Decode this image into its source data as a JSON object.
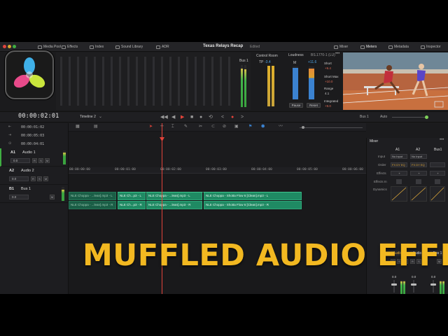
{
  "app": {
    "project_title": "Texas Relays Recap",
    "edited_label": "Edited",
    "colors": {
      "accent_red": "#e3433a",
      "clip_green": "#1f8a63",
      "overlay_yellow": "#f2b821",
      "background": "#1b1b1d"
    }
  },
  "toolbar_left": [
    {
      "label": "Media Pool",
      "icon": "media-pool-icon"
    },
    {
      "label": "Effects",
      "icon": "effects-icon"
    },
    {
      "label": "Index",
      "icon": "index-icon"
    },
    {
      "label": "Sound Library",
      "icon": "sound-library-icon"
    },
    {
      "label": "ADR",
      "icon": "adr-icon"
    }
  ],
  "toolbar_right": [
    {
      "label": "Mixer",
      "icon": "mixer-icon"
    },
    {
      "label": "Meters",
      "icon": "meters-icon"
    },
    {
      "label": "Metadata",
      "icon": "metadata-icon"
    },
    {
      "label": "Inspector",
      "icon": "inspector-icon"
    }
  ],
  "meters": {
    "bus_label": "Bus 1",
    "control_room_label": "Control Room",
    "tp_label": "TP",
    "tp_value": "-3.4",
    "loudness_label": "Loudness",
    "loudness_standard": "BS.1770-1 (LU)",
    "m_label": "M",
    "m_value": "+11.6",
    "pause_label": "Pause",
    "reset_label": "Reset",
    "rows": [
      {
        "label": "Short",
        "value": "+9.4"
      },
      {
        "label": "Short Max",
        "value": "+10.0"
      },
      {
        "label": "Range",
        "value": "4.1"
      },
      {
        "label": "Integrated",
        "value": "+9.0"
      }
    ]
  },
  "transport": {
    "timecode": "00:00:02:01",
    "timeline_name": "Timeline 2",
    "bus_label": "Bus 1",
    "auto_label": "Auto"
  },
  "timeline": {
    "info_rows": [
      "00:00:01:02",
      "00:00:05:03",
      "00:00:04:01"
    ],
    "ruler": [
      "00:00:00:00",
      "00:00:01:00",
      "00:00:02:00",
      "00:00:03:00",
      "00:00:04:00",
      "00:00:05:00",
      "00:00:06:00"
    ],
    "tracks": [
      {
        "id": "A1",
        "name": "Audio 1",
        "volume": "0.0"
      },
      {
        "id": "A2",
        "name": "Audio 2",
        "volume": "0.0"
      },
      {
        "id": "B1",
        "name": "Bus 1",
        "volume": "0.0"
      }
    ],
    "clips_row1": [
      "NLE Choppa - ...lean].mp3 - L",
      "NLE Ch...p3 - L",
      "NLE Choppa - ...lean].mp3 - L",
      "NLE Choppa - Shotta Flow 6 [Clean].mp3 - L"
    ],
    "clips_row2": [
      "NLE Choppa - ...lean].mp3 - R",
      "NLE Ch...p3 - R",
      "NLE Choppa - ...lean].mp3 - R",
      "NLE Choppa - Shotta Flow 6 [Clean].mp3 - R"
    ]
  },
  "mixer": {
    "title": "Mixer",
    "columns": [
      "A1",
      "A2",
      "Bus1"
    ],
    "row_labels": [
      "Input",
      "Order",
      "Effects",
      "Effects In",
      "Dynamics"
    ],
    "input_values": [
      "No Input",
      "No Input"
    ],
    "order_values": [
      "FX DY EQ",
      "FX DY EQ"
    ],
    "strips": [
      "Audio 1",
      "Audio 2",
      "Bus 1"
    ],
    "strip_values": [
      "0.0",
      "0.0",
      "0.0"
    ]
  },
  "overlay_title": "MUFFLED AUDIO EFFECT"
}
